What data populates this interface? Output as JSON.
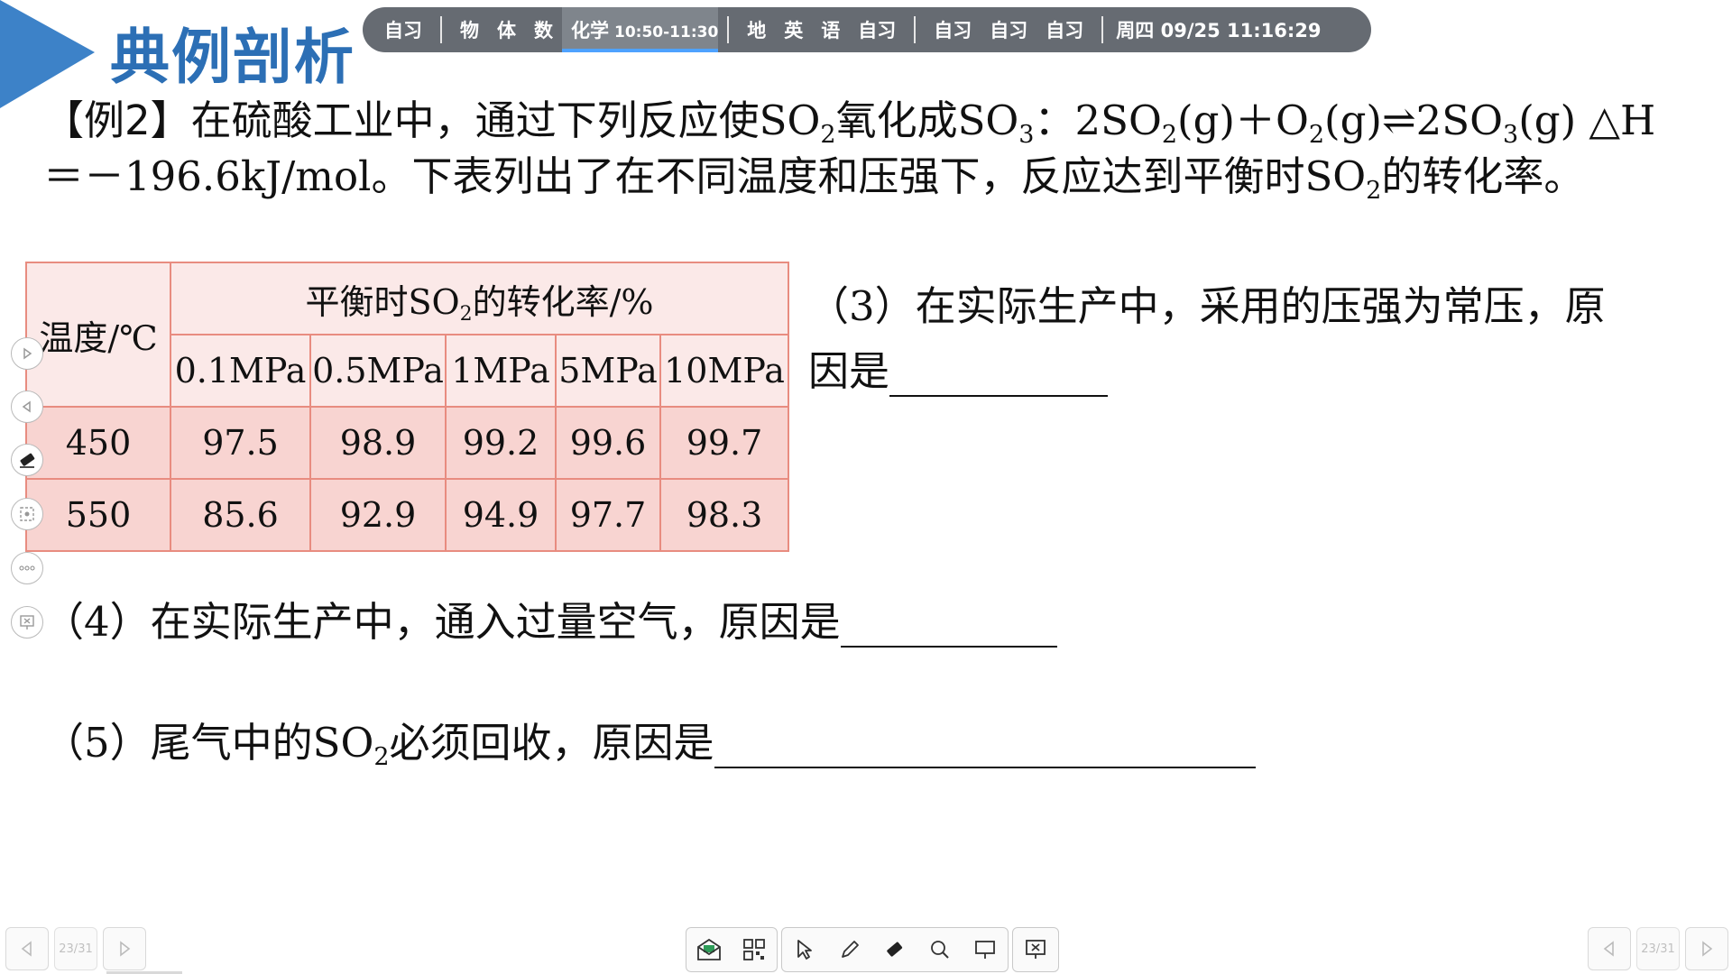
{
  "header": {
    "title": "典例剖析",
    "accent_color": "#3d82c8"
  },
  "schedule": {
    "group1": [
      "自习"
    ],
    "group2": [
      "物",
      "体",
      "数"
    ],
    "active": {
      "subject": "化学",
      "time": "10:50-11:30"
    },
    "group3": [
      "地",
      "英",
      "语",
      "自习"
    ],
    "group4": [
      "自习",
      "自习",
      "自习"
    ],
    "datetime": "周四 09/25  11:16:29"
  },
  "problem": {
    "label": "【例2】",
    "intro_a": "在硫酸工业中，通过下列反应使SO",
    "sub2": "2",
    "intro_b": "氧化成SO",
    "sub3": "3",
    "intro_c": "：2SO",
    "intro_d": "(g)＋O",
    "intro_e": "(g)⇌2SO",
    "intro_f": "(g)    △H",
    "line2_a": "＝－196.6kJ/mol。下表列出了在不同温度和压强下，反应达到平衡时SO",
    "line2_b": "的转化率。"
  },
  "table": {
    "temp_header": "温度/℃",
    "rate_header_a": "平衡时SO",
    "rate_header_b": "的转化率/%",
    "pressures": [
      "0.1MPa",
      "0.5MPa",
      "1MPa",
      "5MPa",
      "10MPa"
    ],
    "rows": [
      {
        "temp": "450",
        "values": [
          "97.5",
          "98.9",
          "99.2",
          "99.6",
          "99.7"
        ]
      },
      {
        "temp": "550",
        "values": [
          "85.6",
          "92.9",
          "94.9",
          "97.7",
          "98.3"
        ]
      }
    ]
  },
  "questions": {
    "q3_line1": "（3）在实际生产中，采用的压强为常压，原",
    "q3_line2": "因是",
    "q4": "（4）在实际生产中，通入过量空气，原因是",
    "q5_a": "（5）尾气中的SO",
    "q5_b": "必须回收，原因是"
  },
  "pager": {
    "left": "23/31",
    "right": "23/31"
  }
}
